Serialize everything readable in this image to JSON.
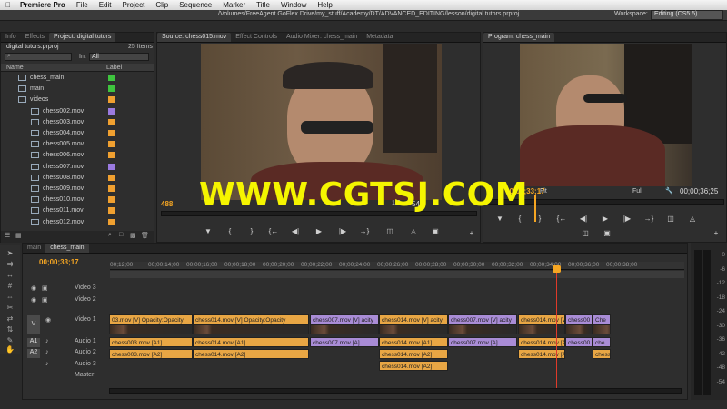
{
  "menubar": {
    "app": "Premiere Pro",
    "items": [
      "File",
      "Edit",
      "Project",
      "Clip",
      "Sequence",
      "Marker",
      "Title",
      "Window",
      "Help"
    ]
  },
  "pathbar": {
    "path": "/Volumes/FreeAgent GoFlex Drive/my_stuff/Academy/DT/ADVANCED_EDITING/lesson/digital tutors.prproj",
    "workspace_label": "Workspace:",
    "workspace_value": "Editing (CS5.5)"
  },
  "project": {
    "tabs": [
      "Info",
      "Effects",
      "Project: digital tutors"
    ],
    "filename": "digital tutors.prproj",
    "count": "25 Items",
    "in_label": "In:",
    "in_value": "All",
    "col_name": "Name",
    "col_label": "Label",
    "items": [
      {
        "name": "chess_main",
        "color": "#3ec43e"
      },
      {
        "name": "main",
        "color": "#3ec43e"
      },
      {
        "name": "videos",
        "color": "#f0a030"
      },
      {
        "name": "chess002.mov",
        "color": "#9a7ae0"
      },
      {
        "name": "chess003.mov",
        "color": "#f0a030"
      },
      {
        "name": "chess004.mov",
        "color": "#f0a030"
      },
      {
        "name": "chess005.mov",
        "color": "#f0a030"
      },
      {
        "name": "chess006.mov",
        "color": "#f0a030"
      },
      {
        "name": "chess007.mov",
        "color": "#9a7ae0"
      },
      {
        "name": "chess008.mov",
        "color": "#f0a030"
      },
      {
        "name": "chess009.mov",
        "color": "#f0a030"
      },
      {
        "name": "chess010.mov",
        "color": "#f0a030"
      },
      {
        "name": "chess011.mov",
        "color": "#f0a030"
      },
      {
        "name": "chess012.mov",
        "color": "#f0a030"
      }
    ]
  },
  "source": {
    "tabs": [
      "Source: chess015.mov",
      "Effect Controls",
      "Audio Mixer: chess_main",
      "Metadata"
    ],
    "timecode": "488",
    "fraction": "1/2",
    "duration": "54"
  },
  "program": {
    "tab": "Program: chess_main",
    "timecode": "00;00;33;17",
    "fit": "Fit",
    "quality": "Full",
    "duration": "00;00;36;25"
  },
  "timeline": {
    "tabs": [
      "main",
      "chess_main"
    ],
    "timecode": "00;00;33;17",
    "ruler": [
      "00;12;00",
      "00;00;14;00",
      "00;00;16;00",
      "00;00;18;00",
      "00;00;20;00",
      "00;00;22;00",
      "00;00;24;00",
      "00;00;26;00",
      "00;00;28;00",
      "00;00;30;00",
      "00;00;32;00",
      "00;00;34;00",
      "00;00;36;00",
      "00;00;38;00"
    ],
    "tracks": {
      "video3": "Video 3",
      "video2": "Video 2",
      "video1": "Video 1",
      "audio1": "Audio 1",
      "audio2": "Audio 2",
      "audio3": "Audio 3",
      "master": "Master",
      "v": "V",
      "a1": "A1",
      "a2": "A2"
    },
    "clips_v1": [
      "03.mov [V] Opacity:Opacity",
      "chess014.mov [V] Opacity:Opacity",
      "chess007.mov [V] acity",
      "chess014.mov [V] acity",
      "chess007.mov [V] acity",
      "chess014.mov [V]",
      "chess00",
      "Che"
    ],
    "clips_a1": [
      "chess003.mov [A1]",
      "chess014.mov [A1]",
      "chess007.mov [A]",
      "chess014.mov [A1]",
      "chess007.mov [A]",
      "chess014.mov [A",
      "chess00",
      "che"
    ],
    "clips_a2": [
      "chess003.mov [A2]",
      "chess014.mov [A2]",
      "chess014.mov [A2]",
      "chess014.mov [A",
      "chess"
    ],
    "clips_a3": [
      "chess014.mov [A2]"
    ]
  },
  "meter": {
    "labels": [
      "0",
      "-6",
      "-12",
      "-18",
      "-24",
      "-30",
      "-36",
      "-42",
      "-48",
      "-54"
    ]
  },
  "watermark": "WWW.CGTSJ.COM",
  "colors": {
    "orange": "#e8a644",
    "purple": "#a98cd6",
    "accent": "#f5a623",
    "playhead": "#e03a2a"
  }
}
